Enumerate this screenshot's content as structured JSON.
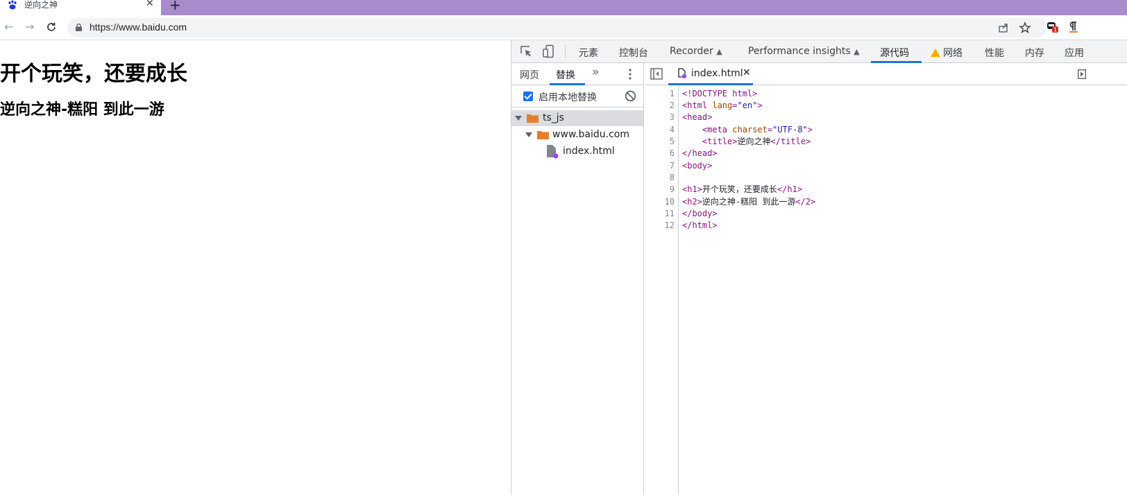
{
  "browser": {
    "tab_title": "逆向之神",
    "url": "https://www.baidu.com",
    "new_tab_label": "+",
    "close_tab_label": "✕",
    "extension_badge": "1"
  },
  "page": {
    "h1": "开个玩笑，还要成长",
    "h2": "逆向之神-糕阳 到此一游"
  },
  "devtools": {
    "tabs": [
      "元素",
      "控制台",
      "Recorder",
      "Performance insights",
      "源代码",
      "网络",
      "性能",
      "内存",
      "应用"
    ],
    "active_tab": "源代码",
    "navigator": {
      "tabs": [
        "网页",
        "替换"
      ],
      "active_tab": "替换",
      "more_label": "»",
      "enable_override_label": "启用本地替换",
      "enable_override_checked": true,
      "tree": [
        {
          "label": "ts_js",
          "type": "folder",
          "expanded": true,
          "selected": true
        },
        {
          "label": "www.baidu.com",
          "type": "folder",
          "expanded": true
        },
        {
          "label": "index.html",
          "type": "file"
        }
      ]
    },
    "editor": {
      "file_tab": "index.html",
      "close_label": "✕",
      "line_numbers": [
        "1",
        "2",
        "3",
        "4",
        "5",
        "6",
        "7",
        "8",
        "9",
        "10",
        "11",
        "12"
      ],
      "code": {
        "l1": "<!DOCTYPE html>",
        "l2_open": "<html ",
        "l2_attr": "lang",
        "l2_eq": "=",
        "l2_val": "\"en\"",
        "l2_close": ">",
        "l3": "<head>",
        "l4_indent": "    ",
        "l4_open": "<meta ",
        "l4_attr": "charset",
        "l4_eq": "=",
        "l4_val": "\"UTF-8\"",
        "l4_close": ">",
        "l5_indent": "    ",
        "l5_open": "<title>",
        "l5_text": "逆向之神",
        "l5_close": "</title>",
        "l6": "</head>",
        "l7": "<body>",
        "l8": "",
        "l9_open": "<h1>",
        "l9_text": "开个玩笑，还要成长",
        "l9_close": "</h1>",
        "l10_open": "<h2>",
        "l10_text": "逆向之神-糕阳 到此一游",
        "l10_close": "</2>",
        "l11": "</body>",
        "l12": "</html>"
      }
    }
  },
  "colors": {
    "tabstrip_accent": "#a78bcb",
    "active_blue": "#1a73e8",
    "folder_orange": "#e37f2d",
    "override_dot": "#a142f4",
    "warning_yellow": "#f9ab00",
    "badge_red": "#d93025"
  }
}
